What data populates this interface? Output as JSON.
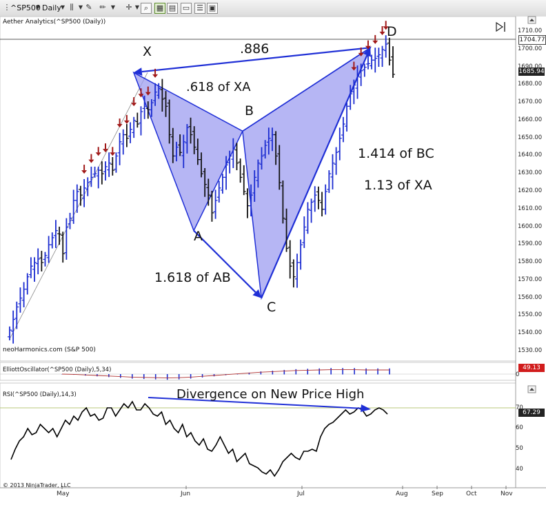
{
  "toolbar": {
    "symbol": "^SP500",
    "interval": "Daily"
  },
  "panels": {
    "price_title": "Aether Analytics(^SP500 (Daily))",
    "watermark": "neoHarmonics.com (S&P 500)",
    "oscillator_title": "ElliottOscillator(^SP500 (Daily),5,34)",
    "rsi_title": "RSI(^SP500 (Daily),14,3)",
    "copyright": "© 2013 NinjaTrader, LLC"
  },
  "price_axis": {
    "ticks": [
      "1710.00",
      "1700.00",
      "1690.00",
      "1680.00",
      "1670.00",
      "1660.00",
      "1650.00",
      "1640.00",
      "1630.00",
      "1620.00",
      "1610.00",
      "1600.00",
      "1590.00",
      "1580.00",
      "1570.00",
      "1560.00",
      "1550.00",
      "1540.00",
      "1530.00"
    ],
    "marker_high": "1704.77",
    "marker_last": "1685.94"
  },
  "oscillator_axis": {
    "value": "49.13",
    "zero": "0"
  },
  "rsi_axis": {
    "ticks": [
      "70",
      "60",
      "50",
      "40"
    ],
    "value": "67.29"
  },
  "x_axis": {
    "labels": [
      "May",
      "Jun",
      "Jul",
      "Aug",
      "Sep",
      "Oct",
      "Nov"
    ]
  },
  "annotations": {
    "point_x": "X",
    "point_a": "A",
    "point_b": "B",
    "point_c": "C",
    "point_d": "D",
    "xd_ratio": ".886",
    "ab_ratio": ".618 of XA",
    "bc_ratio": "1.618 of AB",
    "cd_bc_ratio": "1.414 of BC",
    "cd_xa_ratio": "1.13 of XA",
    "divergence": "Divergence on New Price High"
  },
  "colors": {
    "pattern_fill": "#9d9df0",
    "pattern_line": "#1f2fd6",
    "bar_up": "#1a2bd0",
    "bar_down": "#111111",
    "sell_arrow": "#a01818",
    "oscillator_bars": "#1a2bd0",
    "oscillator_signal": "#b03030",
    "rsi_line": "#000000",
    "rsi_level": "#b8c878",
    "badge_red": "#d11c1c"
  },
  "chart_data": {
    "type": "line",
    "subtype": "ohlc-bar-chart with harmonic pattern overlay",
    "price": {
      "ylim": [
        1527,
        1713
      ],
      "series": [
        1542,
        1548,
        1555,
        1560,
        1565,
        1572,
        1578,
        1580,
        1582,
        1580,
        1584,
        1590,
        1594,
        1598,
        1596,
        1585,
        1600,
        1605,
        1615,
        1620,
        1618,
        1622,
        1625,
        1628,
        1630,
        1632,
        1630,
        1634,
        1636,
        1632,
        1640,
        1648,
        1652,
        1650,
        1655,
        1660,
        1658,
        1665,
        1668,
        1666,
        1670,
        1676,
        1678,
        1672,
        1668,
        1652,
        1640,
        1645,
        1642,
        1648,
        1656,
        1652,
        1645,
        1638,
        1630,
        1624,
        1618,
        1608,
        1615,
        1622,
        1628,
        1635,
        1640,
        1644,
        1636,
        1628,
        1620,
        1612,
        1618,
        1628,
        1636,
        1640,
        1646,
        1650,
        1652,
        1640,
        1625,
        1605,
        1588,
        1578,
        1572,
        1580,
        1590,
        1600,
        1610,
        1614,
        1618,
        1615,
        1610,
        1620,
        1630,
        1636,
        1642,
        1650,
        1658,
        1668,
        1675,
        1680,
        1685,
        1688,
        1690,
        1692,
        1694,
        1695,
        1697,
        1700,
        1703,
        1694,
        1686
      ],
      "pattern": {
        "X": {
          "date": "2013-05-21",
          "price": 1687
        },
        "A": {
          "date": "2013-06-06",
          "price": 1598
        },
        "B": {
          "date": "2013-06-19",
          "price": 1654
        },
        "C": {
          "date": "2013-06-24",
          "price": 1560
        },
        "D": {
          "date": "2013-07-23",
          "price": 1701
        }
      },
      "levels": {
        "recent_high": 1704.77,
        "last": 1685.94
      }
    },
    "oscillator": {
      "series": [
        0,
        -1,
        -3,
        -5,
        -7,
        -9,
        -11,
        -12,
        -13,
        -14,
        -13,
        -11,
        -8,
        -5,
        -2,
        1,
        4,
        7,
        9,
        11,
        13,
        14,
        15,
        16,
        16,
        16,
        15,
        15,
        15
      ],
      "last": 49.13
    },
    "rsi": {
      "ylim": [
        33,
        78
      ],
      "level": 70,
      "series": [
        45,
        50,
        54,
        56,
        60,
        57,
        58,
        62,
        60,
        58,
        60,
        56,
        60,
        64,
        62,
        66,
        64,
        68,
        70,
        66,
        67,
        64,
        65,
        70,
        70,
        66,
        69,
        72,
        70,
        73,
        69,
        69,
        72,
        70,
        67,
        66,
        68,
        62,
        64,
        60,
        58,
        62,
        56,
        58,
        54,
        52,
        55,
        50,
        49,
        52,
        56,
        52,
        48,
        50,
        44,
        46,
        48,
        43,
        42,
        41,
        39,
        38,
        40,
        37,
        40,
        44,
        46,
        48,
        46,
        45,
        49,
        49,
        50,
        49,
        56,
        60,
        62,
        63,
        65,
        67,
        69,
        67,
        68,
        70,
        69,
        66,
        67,
        69,
        70,
        69,
        67
      ]
    }
  }
}
